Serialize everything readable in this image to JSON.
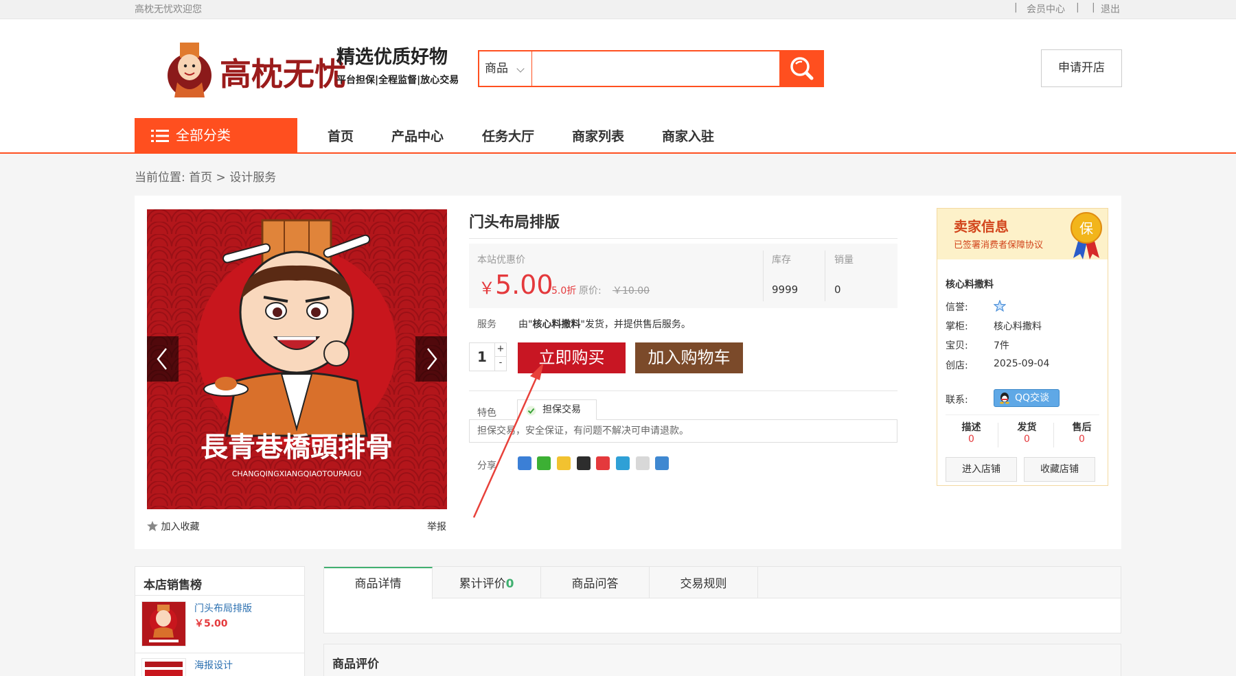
{
  "topbar": {
    "welcome": "高枕无忧欢迎您",
    "sep": "|",
    "member_center": "会员中心",
    "logout": "退出"
  },
  "header": {
    "logo": {
      "brand": "高枕无忧",
      "slogan_main": "精选优质好物",
      "slogan_sub": "平台担保|全程监督|放心交易"
    },
    "search": {
      "category": "商品",
      "query": "",
      "placeholder": ""
    },
    "open_shop": "申请开店"
  },
  "nav": {
    "all_categories": "全部分类",
    "items": [
      "首页",
      "产品中心",
      "任务大厅",
      "商家列表",
      "商家入驻"
    ]
  },
  "breadcrumb": {
    "label": "当前位置:",
    "home": "首页",
    "sep": ">",
    "current": "设计服务"
  },
  "product": {
    "image_text": "長青巷橋頭排骨",
    "image_subtext": "CHANGQINGXIANGQIAOTOUPAIGU",
    "favorite": "加入收藏",
    "report": "举报",
    "title": "门头布局排版",
    "price_label": "本站优惠价",
    "currency": "￥",
    "price": "5.00",
    "discount": "5.0折",
    "original_label": "原价:",
    "original_price": "￥10.00",
    "stock_label": "库存",
    "stock": "9999",
    "sales_label": "销量",
    "sales": "0",
    "service_label": "服务",
    "service_prefix": "由\"",
    "service_shop": "核心料撒料",
    "service_suffix": "\"发货，并提供售后服务。",
    "quantity": "1",
    "qty_plus": "+",
    "qty_minus": "-",
    "buy_now": "立即购买",
    "add_to_cart": "加入购物车",
    "feature_label": "特色",
    "feature_tab": "担保交易",
    "feature_desc": "担保交易，安全保证，有问题不解决可申请退款。",
    "share_label": "分享"
  },
  "seller": {
    "title": "卖家信息",
    "subtitle": "已签署消费者保障协议",
    "seal": "保",
    "shop_name": "核心料撒料",
    "credit_label": "信誉:",
    "keeper_label": "掌柜:",
    "keeper": "核心料撒料",
    "items_label": "宝贝:",
    "items": "7件",
    "created_label": "创店:",
    "created": "2025-09-04",
    "contact_label": "联系:",
    "qq_label": "QQ交谈",
    "ratings": [
      {
        "label": "描述",
        "value": "0"
      },
      {
        "label": "发货",
        "value": "0"
      },
      {
        "label": "售后",
        "value": "0"
      }
    ],
    "enter_shop": "进入店铺",
    "fav_shop": "收藏店铺"
  },
  "ranking": {
    "title": "本店销售榜",
    "items": [
      {
        "name": "门头布局排版",
        "price": "￥5.00"
      },
      {
        "name": "海报设计"
      }
    ]
  },
  "tabs": [
    {
      "label": "商品详情"
    },
    {
      "label": "累计评价",
      "count": "0"
    },
    {
      "label": "商品问答"
    },
    {
      "label": "交易规则"
    }
  ],
  "reviews": {
    "title": "商品评价"
  },
  "colors": {
    "accent": "#ff4f1f",
    "buy": "#c81623",
    "cart": "#7b4a2a",
    "price": "#e4393c",
    "tab_active": "#40b070"
  }
}
